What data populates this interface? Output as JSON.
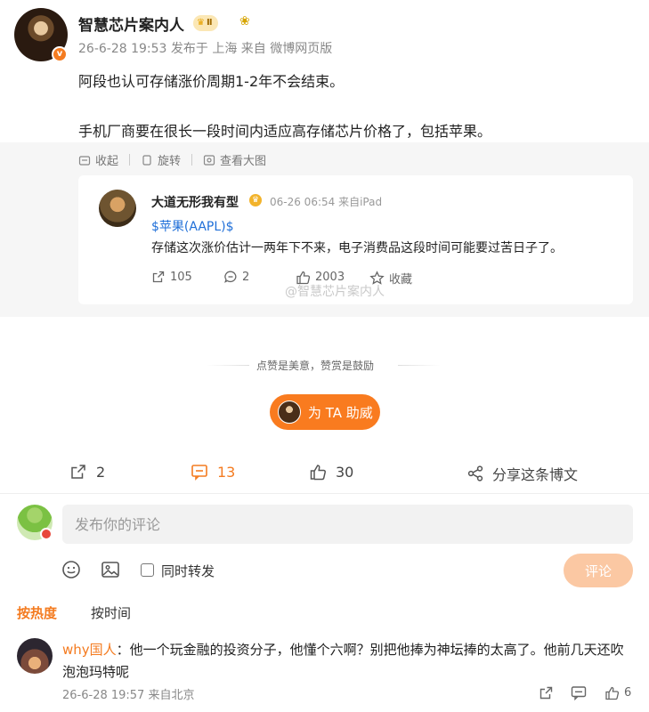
{
  "post": {
    "author": "智慧芯片案内人",
    "vip_level": "Ⅱ",
    "meta": "26-6-28 19:53 发布于 上海 来自 微博网页版",
    "text_line1": "阿段也认可存储涨价周期1-2年不会结束。",
    "text_line2": "手机厂商要在很长一段时间内适应高存储芯片价格了，包括苹果。"
  },
  "tools": {
    "collapse": "收起",
    "rotate": "旋转",
    "view_large": "查看大图"
  },
  "quoted": {
    "author": "大道无形我有型",
    "meta": "06-26 06:54 来自iPad",
    "tag": "$苹果(AAPL)$",
    "text": "存储这次涨价估计一两年下不来，电子消费品这段时间可能要过苦日子了。",
    "reposts": "105",
    "comments": "2",
    "likes": "2003",
    "favorite": "收藏",
    "watermark": "@智慧芯片案内人"
  },
  "reward": {
    "slogan": "点赞是美意，赞赏是鼓励",
    "button": "为 TA 助威"
  },
  "actions": {
    "reposts": "2",
    "comments": "13",
    "likes": "30",
    "share": "分享这条博文"
  },
  "composer": {
    "placeholder": "发布你的评论",
    "forward_label": "同时转发",
    "submit": "评论"
  },
  "sort": {
    "hot": "按热度",
    "time": "按时间"
  },
  "comment": {
    "user": "why国人",
    "text": "：他一个玩金融的投资分子，他懂个六啊？别把他捧为神坛捧的太高了。他前几天还吹泡泡玛特呢",
    "meta": "26-6-28 19:57 来自北京",
    "likes": "6"
  },
  "colors": {
    "accent": "#f47b20",
    "link": "#1f6fd8"
  }
}
